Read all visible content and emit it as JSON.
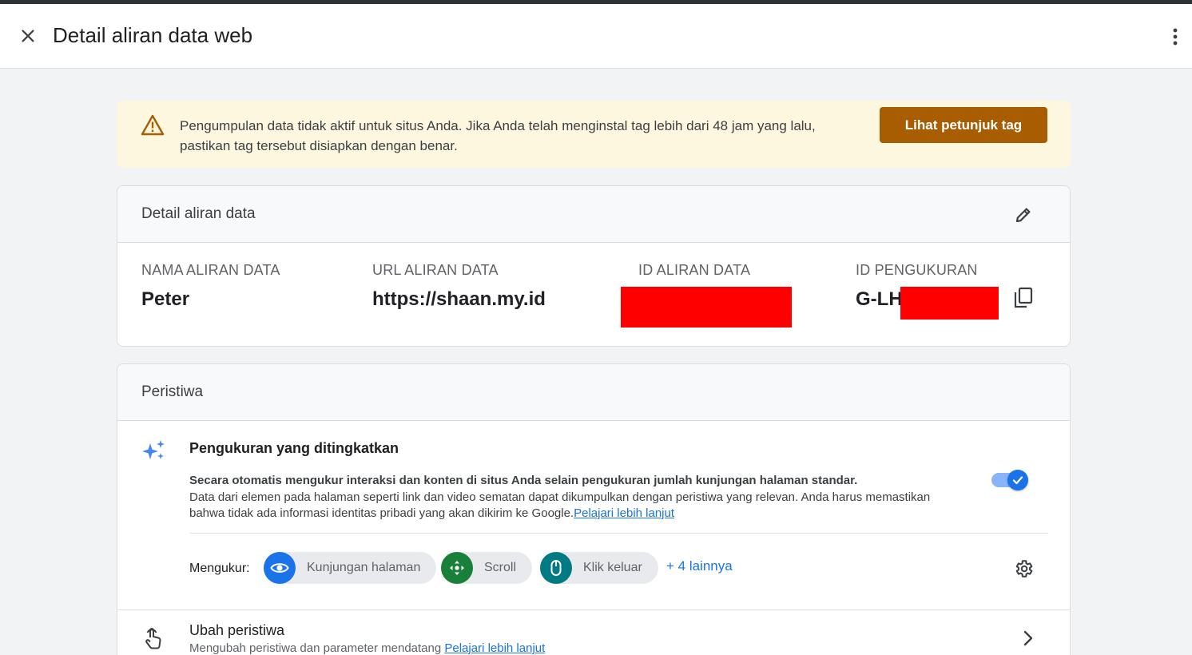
{
  "header": {
    "title": "Detail aliran data web"
  },
  "banner": {
    "message_line1": "Pengumpulan data tidak aktif untuk situs Anda. Jika Anda telah menginstal tag lebih dari 48 jam yang lalu,",
    "message_line2": "pastikan tag tersebut disiapkan dengan benar.",
    "button_label": "Lihat petunjuk tag"
  },
  "stream_details": {
    "title": "Detail aliran data",
    "fields": [
      {
        "label": "NAMA ALIRAN DATA",
        "value": "Peter"
      },
      {
        "label": "URL ALIRAN DATA",
        "value": "https://shaan.my.id"
      },
      {
        "label": "ID ALIRAN DATA",
        "value": ""
      },
      {
        "label": "ID PENGUKURAN",
        "value": "G-LH"
      }
    ]
  },
  "events": {
    "title": "Peristiwa",
    "enhanced": {
      "title": "Pengukuran yang ditingkatkan",
      "desc_bold": "Secara otomatis mengukur interaksi dan konten di situs Anda selain pengukuran jumlah kunjungan halaman standar.",
      "desc_line1": "Data dari elemen pada halaman seperti link dan video sematan dapat dikumpulkan dengan peristiwa yang relevan. Anda harus memastikan",
      "desc_line2": "bahwa tidak ada informasi identitas pribadi yang akan dikirim ke Google.",
      "learn_more": "Pelajari lebih lanjut",
      "enabled": true,
      "measure_label": "Mengukur:",
      "chips": [
        {
          "label": "Kunjungan halaman",
          "color": "#1a73e8",
          "icon": "eye-icon"
        },
        {
          "label": "Scroll",
          "color": "#188038",
          "icon": "move-arrows-icon"
        },
        {
          "label": "Klik keluar",
          "color": "#007b83",
          "icon": "mouse-icon"
        }
      ],
      "more": "+ 4 lainnya"
    },
    "modify": {
      "title": "Ubah peristiwa",
      "subtitle": "Mengubah peristiwa dan parameter mendatang",
      "learn_more": "Pelajari lebih lanjut"
    }
  }
}
